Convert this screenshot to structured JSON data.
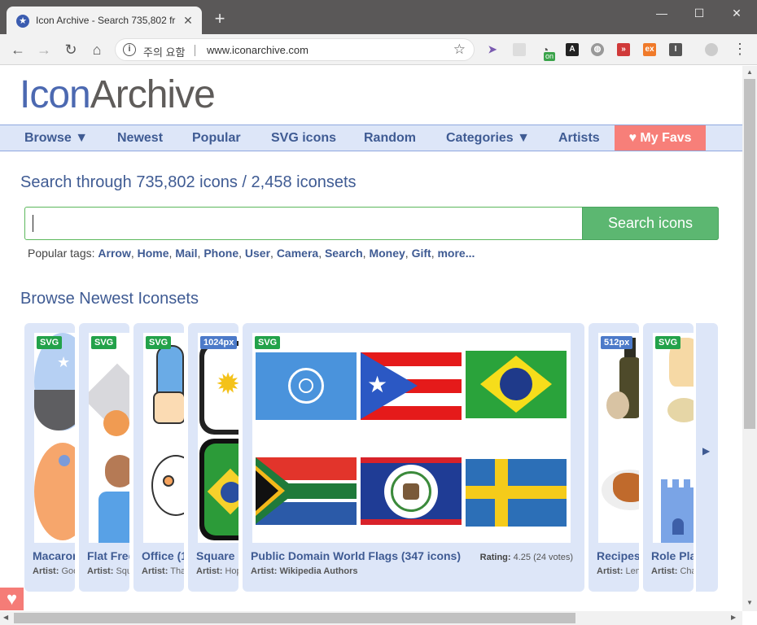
{
  "browser": {
    "tab_title": "Icon Archive - Search 735,802 fr",
    "tab_close": "✕",
    "new_tab": "+",
    "url": "www.iconarchive.com",
    "security_label": "주의 요함",
    "extension_badge": "on"
  },
  "site": {
    "logo_part1": "Icon",
    "logo_part2": "Archive",
    "nav": [
      {
        "label": "Browse ▼"
      },
      {
        "label": "Newest"
      },
      {
        "label": "Popular"
      },
      {
        "label": "SVG icons"
      },
      {
        "label": "Random"
      },
      {
        "label": "Categories ▼"
      },
      {
        "label": "Artists"
      }
    ],
    "favs_label": "♥ My Favs",
    "search_heading": "Search through 735,802 icons / 2,458 iconsets",
    "search_value": "",
    "search_button": "Search icons",
    "tags_prefix": "Popular tags:",
    "tags": [
      "Arrow",
      "Home",
      "Mail",
      "Phone",
      "User",
      "Camera",
      "Search",
      "Money",
      "Gift",
      "more..."
    ],
    "browse_heading": "Browse Newest Iconsets"
  },
  "iconsets": [
    {
      "badge": "SVG",
      "name": "Macaron",
      "artist_label": "Artist:",
      "artist": "Goo"
    },
    {
      "badge": "SVG",
      "name": "Flat Free",
      "artist_label": "Artist:",
      "artist": "Squ"
    },
    {
      "badge": "SVG",
      "name": "Office (1",
      "artist_label": "Artist:",
      "artist": "Tha"
    },
    {
      "badge": "1024px",
      "name": "Square",
      "artist_label": "Artist:",
      "artist": "Hop"
    },
    {
      "badge": "SVG",
      "name": "Public Domain World Flags (347 icons)",
      "artist_label": "Artist:",
      "artist": "Wikipedia Authors",
      "rating_label": "Rating:",
      "rating": "4.25 (24 votes)"
    },
    {
      "badge": "512px",
      "name": "Recipes",
      "artist_label": "Artist:",
      "artist": "Len"
    },
    {
      "badge": "SVG",
      "name": "Role Pla",
      "artist_label": "Artist:",
      "artist": "Cha"
    }
  ],
  "next_arrow": "▶",
  "colors": {
    "brand_blue": "#4c69b1",
    "brand_gray": "#5f5c5a",
    "nav_bg": "#dde6f8",
    "search_green": "#5cb771",
    "favs_red": "#f77f79"
  }
}
